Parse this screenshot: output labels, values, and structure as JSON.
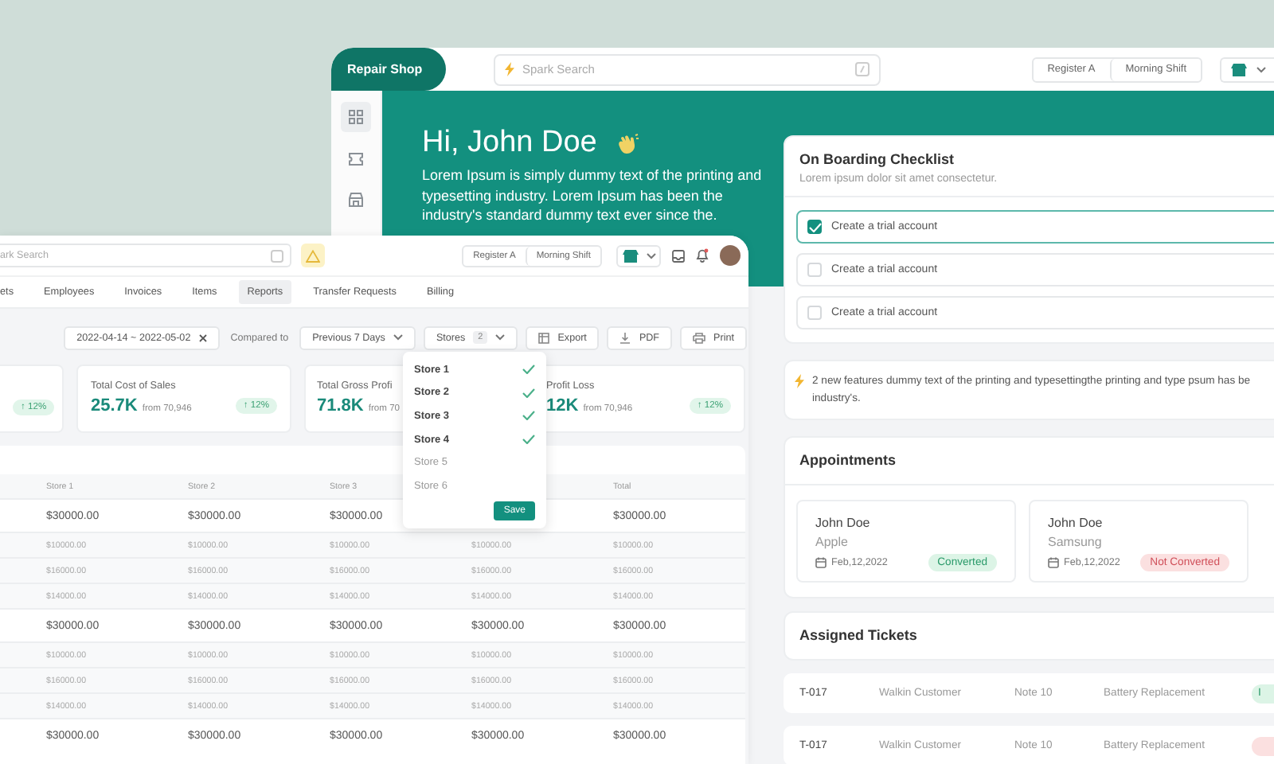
{
  "back_window": {
    "brand": "Repair Shop",
    "search": {
      "placeholder": "Spark Search"
    },
    "register": "Register A",
    "shift": "Morning Shift",
    "sidebar": {
      "items": [
        {
          "kind": "grid",
          "selected": true
        },
        {
          "kind": "ticket",
          "selected": false
        },
        {
          "kind": "store",
          "selected": false
        }
      ]
    },
    "hero": {
      "title": "Hi, John Doe",
      "text": "Lorem Ipsum is simply dummy text of the printing and typesetting industry. Lorem Ipsum has been the industry's standard dummy text ever since the."
    },
    "checklist": {
      "title": "On Boarding Checklist",
      "subtitle": "Lorem ipsum dolor sit amet consectetur.",
      "items": [
        {
          "label": "Create a trial account",
          "checked": true
        },
        {
          "label": "Create a trial account",
          "checked": false
        },
        {
          "label": "Create a trial account",
          "checked": false
        }
      ]
    },
    "notice": {
      "text": "2 new features dummy text of the printing and typesettingthe printing and type psum has be\nindustry's."
    },
    "appointments": {
      "title": "Appointments",
      "items": [
        {
          "name": "John Doe",
          "brand": "Apple",
          "date": "Feb,12,2022",
          "status": "Converted",
          "converted": true
        },
        {
          "name": "John Doe",
          "brand": "Samsung",
          "date": "Feb,12,2022",
          "status": "Not Converted",
          "converted": false
        }
      ]
    },
    "tickets": {
      "title": "Assigned Tickets",
      "rows": [
        {
          "id": "T-017",
          "customer": "Walkin Customer",
          "device": "Note 10",
          "service": "Battery Replacement",
          "status": "I",
          "color": "#dcf4e6"
        },
        {
          "id": "T-017",
          "customer": "Walkin Customer",
          "device": "Note 10",
          "service": "Battery Replacement",
          "color": "#fbe0e0"
        }
      ]
    }
  },
  "front_window": {
    "search": {
      "placeholder": "ark Search"
    },
    "register": "Register A",
    "shift": "Morning Shift",
    "tabs": [
      {
        "label": "ets",
        "selected": false
      },
      {
        "label": "Employees",
        "selected": false
      },
      {
        "label": "Invoices",
        "selected": false
      },
      {
        "label": "Items",
        "selected": false
      },
      {
        "label": "Reports",
        "selected": true
      },
      {
        "label": "Transfer Requests",
        "selected": false
      },
      {
        "label": "Billing",
        "selected": false
      }
    ],
    "filters": {
      "date_range": "2022-04-14 ~ 2022-05-02",
      "compared_label": "Compared to",
      "compared_value": "Previous 7 Days",
      "stores_label": "Stores",
      "stores_count": "2",
      "actions": [
        {
          "kind": "export",
          "label": "Export"
        },
        {
          "kind": "pdf",
          "label": "PDF"
        },
        {
          "kind": "print",
          "label": "Print"
        }
      ]
    },
    "kpis": [
      {
        "change": "↑ 12%"
      },
      {
        "title": "Total Cost of Sales",
        "value": "25.7K",
        "from": "from 70,946",
        "change": "↑ 12%"
      },
      {
        "title": "Total Gross Profi",
        "value": "71.8K",
        "from": "from 70"
      },
      {
        "title": "Profit Loss",
        "value": "12K",
        "from": "from 70,946",
        "change": "↑ 12%"
      }
    ],
    "table": {
      "columns": [
        "Store 1",
        "Store 2",
        "Store 3",
        null,
        "Total"
      ],
      "rows": [
        {
          "kind": "subtotal",
          "cells": [
            "$30000.00",
            "$30000.00",
            "$30000.00",
            null,
            "$30000.00"
          ]
        },
        {
          "kind": "detail",
          "cells": [
            "$10000.00",
            "$10000.00",
            "$10000.00",
            "$10000.00",
            "$10000.00"
          ]
        },
        {
          "kind": "detail",
          "cells": [
            "$16000.00",
            "$16000.00",
            "$16000.00",
            "$16000.00",
            "$16000.00"
          ]
        },
        {
          "kind": "detail",
          "cells": [
            "$14000.00",
            "$14000.00",
            "$14000.00",
            "$14000.00",
            "$14000.00"
          ]
        },
        {
          "kind": "subtotal",
          "cells": [
            "$30000.00",
            "$30000.00",
            "$30000.00",
            "$30000.00",
            "$30000.00"
          ]
        },
        {
          "kind": "detail",
          "cells": [
            "$10000.00",
            "$10000.00",
            "$10000.00",
            "$10000.00",
            "$10000.00"
          ]
        },
        {
          "kind": "detail",
          "cells": [
            "$16000.00",
            "$16000.00",
            "$16000.00",
            "$16000.00",
            "$16000.00"
          ]
        },
        {
          "kind": "detail",
          "cells": [
            "$14000.00",
            "$14000.00",
            "$14000.00",
            "$14000.00",
            "$14000.00"
          ]
        },
        {
          "kind": "subtotal",
          "cells": [
            "$30000.00",
            "$30000.00",
            "$30000.00",
            "$30000.00",
            "$30000.00"
          ]
        }
      ]
    },
    "store_dropdown": {
      "items": [
        {
          "label": "Store 1",
          "checked": true
        },
        {
          "label": "Store 2",
          "checked": true
        },
        {
          "label": "Store 3",
          "checked": true
        },
        {
          "label": "Store 4",
          "checked": true
        },
        {
          "label": "Store 5",
          "checked": false
        },
        {
          "label": "Store 6",
          "checked": false
        }
      ],
      "save": "Save"
    }
  }
}
